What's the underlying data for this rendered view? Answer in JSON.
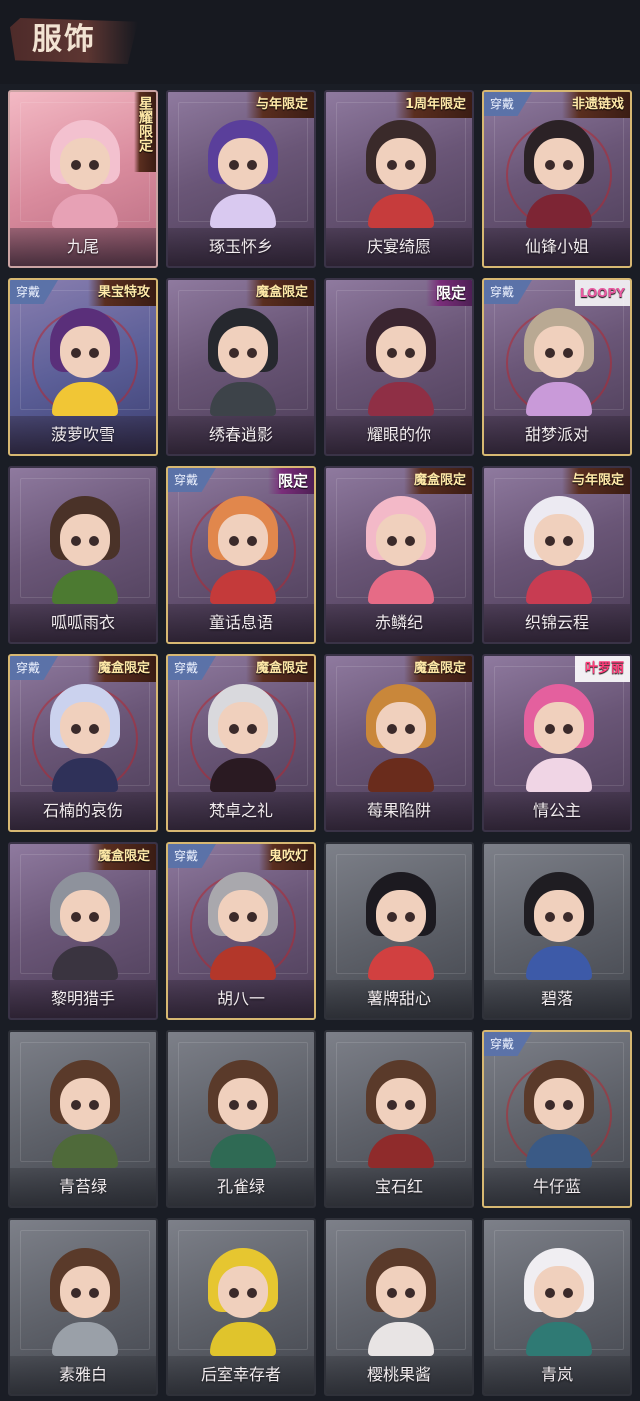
{
  "header": {
    "title": "服饰"
  },
  "labels": {
    "worn": "穿戴"
  },
  "colors": {
    "card_purple": "#6a5677",
    "card_gray": "#5e6169",
    "equipped_border": "#d7b872",
    "worn_badge": "#5b72a8"
  },
  "items": [
    {
      "name": "九尾",
      "tag": "星耀限定",
      "style": "pink",
      "worn": false,
      "hair": "#f3c1cf",
      "outfit": "#e7a1b5",
      "tag_style": "vertical"
    },
    {
      "name": "琢玉怀乡",
      "tag": "与年限定",
      "style": "purple",
      "worn": false,
      "hair": "#5a3f9b",
      "outfit": "#d9c9f0",
      "tag_style": "normal"
    },
    {
      "name": "庆宴绮愿",
      "tag": "1周年限定",
      "style": "purple",
      "worn": false,
      "hair": "#3a2a2a",
      "outfit": "#c63c3c",
      "tag_style": "normal"
    },
    {
      "name": "仙锋小姐",
      "tag": "非遗链戏",
      "style": "purple",
      "worn": true,
      "hair": "#2b2226",
      "outfit": "#7d2534",
      "tag_style": "normal"
    },
    {
      "name": "菠萝吹雪",
      "tag": "果宝特攻",
      "style": "blue",
      "worn": true,
      "hair": "#5a2f7a",
      "outfit": "#f1c635",
      "tag_style": "normal"
    },
    {
      "name": "绣春逍影",
      "tag": "魔盒限定",
      "style": "purple",
      "worn": false,
      "hair": "#26282e",
      "outfit": "#3d4349",
      "tag_style": "normal"
    },
    {
      "name": "耀眼的你",
      "tag": "限定",
      "style": "purple",
      "worn": false,
      "hair": "#3a2530",
      "outfit": "#8f2f45",
      "tag_style": "limited"
    },
    {
      "name": "甜梦派对",
      "tag": "LOOPY",
      "style": "purple",
      "worn": true,
      "hair": "#b9a993",
      "outfit": "#c99ad9",
      "tag_style": "loopy"
    },
    {
      "name": "呱呱雨衣",
      "tag": "",
      "style": "purple",
      "worn": false,
      "hair": "#4a3228",
      "outfit": "#4c7a31",
      "tag_style": "normal"
    },
    {
      "name": "童话息语",
      "tag": "限定",
      "style": "purple",
      "worn": true,
      "hair": "#e1874c",
      "outfit": "#c43a3a",
      "tag_style": "limited"
    },
    {
      "name": "赤鳞纪",
      "tag": "魔盒限定",
      "style": "purple",
      "worn": false,
      "hair": "#f3b9c8",
      "outfit": "#e66b86",
      "tag_style": "normal"
    },
    {
      "name": "织锦云程",
      "tag": "与年限定",
      "style": "purple",
      "worn": false,
      "hair": "#eceaf2",
      "outfit": "#c83c52",
      "tag_style": "normal"
    },
    {
      "name": "石楠的哀伤",
      "tag": "魔盒限定",
      "style": "purple",
      "worn": true,
      "hair": "#cbd2ee",
      "outfit": "#2f3159",
      "tag_style": "normal"
    },
    {
      "name": "梵卓之礼",
      "tag": "魔盒限定",
      "style": "purple",
      "worn": true,
      "hair": "#d9d9dd",
      "outfit": "#2a1a22",
      "tag_style": "normal"
    },
    {
      "name": "莓果陷阱",
      "tag": "魔盒限定",
      "style": "purple",
      "worn": false,
      "hair": "#c9873a",
      "outfit": "#6a2c1c",
      "tag_style": "normal"
    },
    {
      "name": "情公主",
      "tag": "叶罗丽",
      "style": "purple",
      "worn": false,
      "hair": "#e4609e",
      "outfit": "#f0d5e5",
      "tag_style": "pink"
    },
    {
      "name": "黎明猎手",
      "tag": "魔盒限定",
      "style": "purple",
      "worn": false,
      "hair": "#8e929c",
      "outfit": "#3a3440",
      "tag_style": "normal"
    },
    {
      "name": "胡八一",
      "tag": "鬼吹灯",
      "style": "purple",
      "worn": true,
      "hair": "#a9a8ad",
      "outfit": "#b3372a",
      "tag_style": "normal"
    },
    {
      "name": "薯牌甜心",
      "tag": "",
      "style": "gray",
      "worn": false,
      "hair": "#1c1a20",
      "outfit": "#d14040",
      "tag_style": "normal"
    },
    {
      "name": "碧落",
      "tag": "",
      "style": "gray",
      "worn": false,
      "hair": "#1f1d22",
      "outfit": "#3d5aa8",
      "tag_style": "normal"
    },
    {
      "name": "青苔绿",
      "tag": "",
      "style": "gray",
      "worn": false,
      "hair": "#5a3a2a",
      "outfit": "#4f6a3a",
      "tag_style": "normal"
    },
    {
      "name": "孔雀绿",
      "tag": "",
      "style": "gray",
      "worn": false,
      "hair": "#5a3a2a",
      "outfit": "#2f6a54",
      "tag_style": "normal"
    },
    {
      "name": "宝石红",
      "tag": "",
      "style": "gray",
      "worn": false,
      "hair": "#5a3a2a",
      "outfit": "#8f2b2b",
      "tag_style": "normal"
    },
    {
      "name": "牛仔蓝",
      "tag": "",
      "style": "gray",
      "worn": true,
      "hair": "#5a3a2a",
      "outfit": "#3a5a86",
      "tag_style": "normal"
    },
    {
      "name": "素雅白",
      "tag": "",
      "style": "gray",
      "worn": false,
      "hair": "#5a3a2a",
      "outfit": "#9aa0a8",
      "tag_style": "normal"
    },
    {
      "name": "后室幸存者",
      "tag": "",
      "style": "gray",
      "worn": false,
      "hair": "#e6c630",
      "outfit": "#e0c42c",
      "tag_style": "normal"
    },
    {
      "name": "樱桃果酱",
      "tag": "",
      "style": "gray",
      "worn": false,
      "hair": "#5a3a2a",
      "outfit": "#e8e4e4",
      "tag_style": "normal"
    },
    {
      "name": "青岚",
      "tag": "",
      "style": "gray",
      "worn": false,
      "hair": "#f0eef2",
      "outfit": "#2f7a74",
      "tag_style": "normal"
    }
  ]
}
